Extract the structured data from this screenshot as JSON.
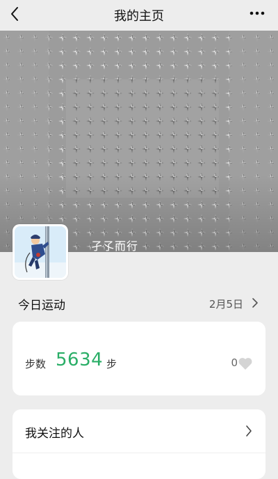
{
  "header": {
    "title": "我的主页",
    "back_icon": "chevron-left-icon",
    "more_icon": "more-dots-icon"
  },
  "profile": {
    "nickname": "孑孓而行"
  },
  "today": {
    "section_label": "今日运动",
    "date": "2月5日",
    "steps_label": "步数",
    "steps_value": "5634",
    "steps_unit": "步",
    "likes_count": "0"
  },
  "following": {
    "label": "我关注的人",
    "next_row_label": ""
  },
  "colors": {
    "accent_green": "#2aae67",
    "background": "#ededed",
    "card": "#ffffff"
  }
}
